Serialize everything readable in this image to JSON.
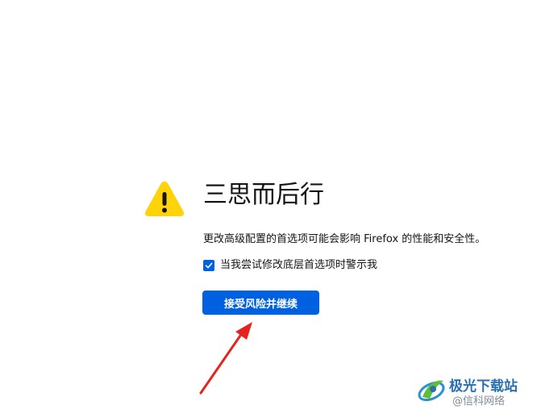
{
  "warning": {
    "icon": "warning-triangle-icon",
    "color": "#ffd30a"
  },
  "title": "三思而后行",
  "description": "更改高级配置的首选项可能会影响 Firefox 的性能和安全性。",
  "checkbox": {
    "label": "当我尝试修改底层首选项时警示我",
    "checked": true
  },
  "accept_button": {
    "label": "接受风险并继续"
  },
  "colors": {
    "accent": "#0061e0",
    "text": "#15141a",
    "annotation": "#e52420"
  },
  "watermark": {
    "site": "极光下载站",
    "credit": "@信科网络"
  }
}
